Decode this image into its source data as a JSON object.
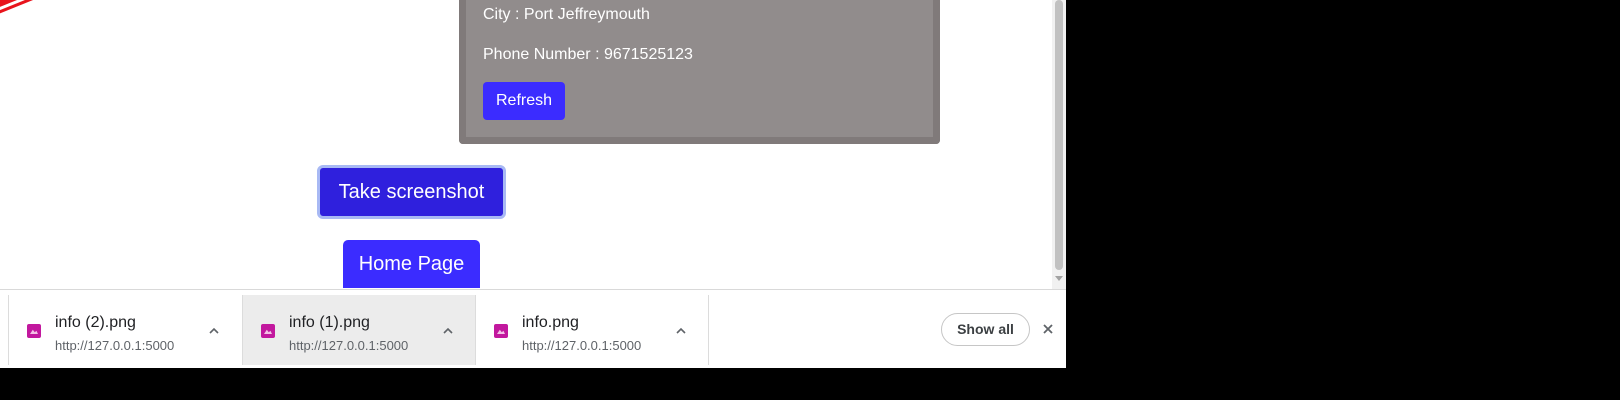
{
  "card": {
    "city": "City : Port Jeffreymouth",
    "phone": "Phone Number : 9671525123",
    "refresh_label": "Refresh"
  },
  "buttons": {
    "take_screenshot": "Take screenshot",
    "home_page": "Home Page"
  },
  "downloads": {
    "items": [
      {
        "name": "info (2).png",
        "url": "http://127.0.0.1:5000"
      },
      {
        "name": "info (1).png",
        "url": "http://127.0.0.1:5000"
      },
      {
        "name": "info.png",
        "url": "http://127.0.0.1:5000"
      }
    ],
    "show_all_label": "Show all"
  },
  "icons": {
    "file": "image-file-icon",
    "chevron": "chevron-up-icon",
    "close": "close-icon"
  },
  "colors": {
    "primary_button": "#3b2cff",
    "focused_button": "#2f20dd",
    "card_background": "#918c8c",
    "stamp": "#e8141c",
    "file_icon": "#c2189e"
  }
}
